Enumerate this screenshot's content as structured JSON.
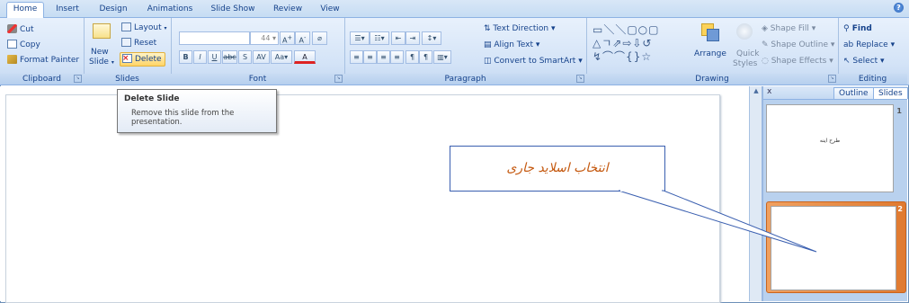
{
  "tabs": [
    "Home",
    "Insert",
    "Design",
    "Animations",
    "Slide Show",
    "Review",
    "View"
  ],
  "clipboard": {
    "cut": "Cut",
    "copy": "Copy",
    "format_painter": "Format Painter",
    "group_label": "Clipboard"
  },
  "slides": {
    "new_slide_line1": "New",
    "new_slide_line2": "Slide",
    "layout": "Layout",
    "reset": "Reset",
    "delete": "Delete",
    "group_label": "Slides"
  },
  "font": {
    "size": "44",
    "group_label": "Font"
  },
  "paragraph": {
    "text_direction": "Text Direction",
    "align_text": "Align Text",
    "convert_smartart": "Convert to SmartArt",
    "group_label": "Paragraph"
  },
  "drawing": {
    "arrange": "Arrange",
    "quick_styles_1": "Quick",
    "quick_styles_2": "Styles",
    "shape_fill": "Shape Fill",
    "shape_outline": "Shape Outline",
    "shape_effects": "Shape Effects",
    "group_label": "Drawing"
  },
  "editing": {
    "find": "Find",
    "replace": "Replace",
    "select": "Select",
    "group_label": "Editing"
  },
  "tooltip": {
    "title": "Delete Slide",
    "body": "Remove this slide from the presentation."
  },
  "pane": {
    "close": "x",
    "outline_tab": "Outline",
    "slides_tab": "Slides"
  },
  "thumbnails": [
    {
      "number": "1",
      "text": "طرح اینه"
    },
    {
      "number": "2",
      "text": ""
    }
  ],
  "callout": {
    "text": "انتخاب اسلاید جاری"
  },
  "colors": {
    "accent_orange": "#e07a30",
    "callout_text": "#c55a11",
    "ribbon_text": "#15428b"
  }
}
